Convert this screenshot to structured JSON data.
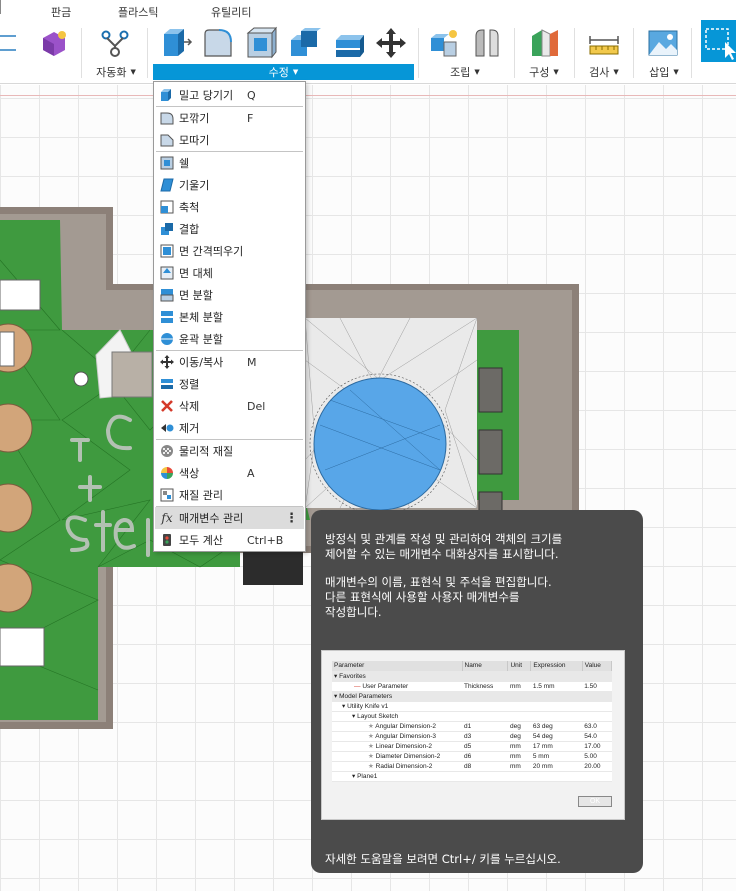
{
  "ribbon": {
    "tabs": [
      "판금",
      "플라스틱",
      "유틸리티"
    ],
    "groups": {
      "automate": "자동화",
      "modify": "수정",
      "assemble": "조립",
      "configure": "구성",
      "inspect": "검사",
      "insert": "삽입"
    },
    "colors": {
      "accent": "#0696d7",
      "menu_highlight": "#dcdcdc"
    }
  },
  "menu": {
    "items": [
      {
        "label": "밀고 당기기",
        "shortcut": "Q",
        "icon": "press-pull-icon"
      },
      {
        "label": "모깎기",
        "shortcut": "F",
        "icon": "fillet-icon"
      },
      {
        "label": "모따기",
        "shortcut": "",
        "icon": "chamfer-icon"
      },
      {
        "label": "쉘",
        "shortcut": "",
        "icon": "shell-icon"
      },
      {
        "label": "기울기",
        "shortcut": "",
        "icon": "draft-icon"
      },
      {
        "label": "축척",
        "shortcut": "",
        "icon": "scale-icon"
      },
      {
        "label": "결합",
        "shortcut": "",
        "icon": "combine-icon"
      },
      {
        "label": "면 간격띄우기",
        "shortcut": "",
        "icon": "offset-face-icon"
      },
      {
        "label": "면 대체",
        "shortcut": "",
        "icon": "replace-face-icon"
      },
      {
        "label": "면 분할",
        "shortcut": "",
        "icon": "split-face-icon"
      },
      {
        "label": "본체 분할",
        "shortcut": "",
        "icon": "split-body-icon"
      },
      {
        "label": "윤곽 분할",
        "shortcut": "",
        "icon": "silhouette-split-icon"
      },
      {
        "label": "이동/복사",
        "shortcut": "M",
        "icon": "move-icon"
      },
      {
        "label": "정렬",
        "shortcut": "",
        "icon": "align-icon"
      },
      {
        "label": "삭제",
        "shortcut": "Del",
        "icon": "delete-icon"
      },
      {
        "label": "제거",
        "shortcut": "",
        "icon": "remove-icon"
      },
      {
        "label": "물리적 재질",
        "shortcut": "",
        "icon": "physical-material-icon"
      },
      {
        "label": "색상",
        "shortcut": "A",
        "icon": "appearance-icon"
      },
      {
        "label": "재질 관리",
        "shortcut": "",
        "icon": "manage-materials-icon"
      },
      {
        "label": "매개변수 관리",
        "shortcut": "",
        "icon": "fx-icon"
      },
      {
        "label": "모두 계산",
        "shortcut": "Ctrl+B",
        "icon": "compute-all-icon"
      }
    ],
    "more_glyph": "⋮"
  },
  "tooltip": {
    "para1_l1": "방정식 및 관계를 작성 및 관리하여 객체의 크기를",
    "para1_l2": "제어할 수 있는 매개변수 대화상자를 표시합니다.",
    "para2_l1": "매개변수의 이름, 표현식 및 주석을 편집합니다.",
    "para2_l2": "다른 표현식에 사용할 사용자 매개변수를",
    "para2_l3": "작성합니다.",
    "footer": "자세한 도움말을 보려면 Ctrl+/ 키를 누르십시오.",
    "preview": {
      "headers": [
        "Parameter",
        "Name",
        "Unit",
        "Expression",
        "Value"
      ],
      "favorites": "Favorites",
      "user_param": {
        "param": "User Parameter",
        "name": "Thickness",
        "unit": "mm",
        "expr": "1.5 mm",
        "value": "1.50"
      },
      "model_params": "Model Parameters",
      "component": "Utility Knife v1",
      "sketch": "Layout Sketch",
      "rows": [
        {
          "param": "Angular Dimension-2",
          "name": "d1",
          "unit": "deg",
          "expr": "63 deg",
          "value": "63.0"
        },
        {
          "param": "Angular Dimension-3",
          "name": "d3",
          "unit": "deg",
          "expr": "54 deg",
          "value": "54.0"
        },
        {
          "param": "Linear Dimension-2",
          "name": "d5",
          "unit": "mm",
          "expr": "17 mm",
          "value": "17.00"
        },
        {
          "param": "Diameter Dimension-2",
          "name": "d6",
          "unit": "mm",
          "expr": "5 mm",
          "value": "5.00"
        },
        {
          "param": "Radial Dimension-2",
          "name": "d8",
          "unit": "mm",
          "expr": "20 mm",
          "value": "20.00"
        }
      ],
      "plane": "Plane1",
      "ok": "OK"
    }
  }
}
